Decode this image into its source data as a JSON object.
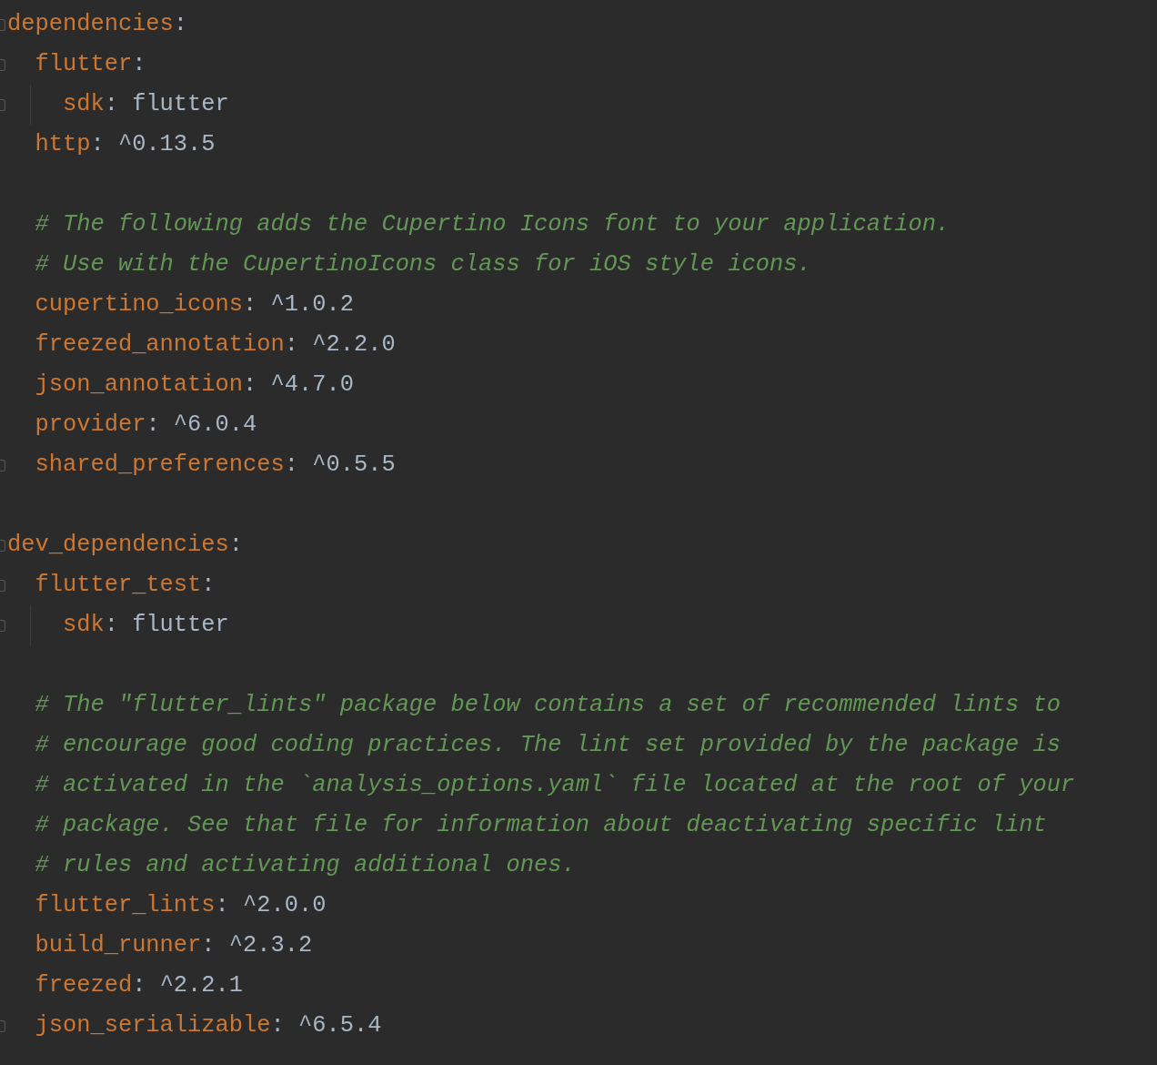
{
  "editor": {
    "lines": [
      {
        "kind": "key",
        "key": "dependencies",
        "separator": ":",
        "fold_marker": true,
        "children": [
          {
            "kind": "key",
            "key": "flutter",
            "separator": ":",
            "fold_marker": true,
            "children": [
              {
                "kind": "key",
                "key": "sdk",
                "separator": ":",
                "value": "flutter",
                "fold_marker": true
              }
            ]
          },
          {
            "kind": "key",
            "key": "http",
            "separator": ":",
            "value": "^0.13.5",
            "fold_marker": false
          },
          {
            "kind": "blank"
          },
          {
            "kind": "comment",
            "text": "# The following adds the Cupertino Icons font to your application."
          },
          {
            "kind": "comment",
            "text": "# Use with the CupertinoIcons class for iOS style icons."
          },
          {
            "kind": "key",
            "key": "cupertino_icons",
            "separator": ":",
            "value": "^1.0.2",
            "fold_marker": false
          },
          {
            "kind": "key",
            "key": "freezed_annotation",
            "separator": ":",
            "value": "^2.2.0",
            "fold_marker": false
          },
          {
            "kind": "key",
            "key": "json_annotation",
            "separator": ":",
            "value": "^4.7.0",
            "fold_marker": false
          },
          {
            "kind": "key",
            "key": "provider",
            "separator": ":",
            "value": "^6.0.4",
            "fold_marker": false
          },
          {
            "kind": "key",
            "key": "shared_preferences",
            "separator": ":",
            "value": "^0.5.5",
            "fold_marker": true
          }
        ]
      },
      {
        "kind": "blank"
      },
      {
        "kind": "key",
        "key": "dev_dependencies",
        "separator": ":",
        "fold_marker": true,
        "children": [
          {
            "kind": "key",
            "key": "flutter_test",
            "separator": ":",
            "fold_marker": true,
            "children": [
              {
                "kind": "key",
                "key": "sdk",
                "separator": ":",
                "value": "flutter",
                "fold_marker": true
              }
            ]
          },
          {
            "kind": "blank"
          },
          {
            "kind": "comment",
            "text": "# The \"flutter_lints\" package below contains a set of recommended lints to"
          },
          {
            "kind": "comment",
            "text": "# encourage good coding practices. The lint set provided by the package is"
          },
          {
            "kind": "comment",
            "text": "# activated in the `analysis_options.yaml` file located at the root of your"
          },
          {
            "kind": "comment",
            "text": "# package. See that file for information about deactivating specific lint"
          },
          {
            "kind": "comment",
            "text": "# rules and activating additional ones."
          },
          {
            "kind": "key",
            "key": "flutter_lints",
            "separator": ":",
            "value": "^2.0.0",
            "fold_marker": false
          },
          {
            "kind": "key",
            "key": "build_runner",
            "separator": ":",
            "value": "^2.3.2",
            "fold_marker": false
          },
          {
            "kind": "key",
            "key": "freezed",
            "separator": ":",
            "value": "^2.2.1",
            "fold_marker": false
          },
          {
            "kind": "key",
            "key": "json_serializable",
            "separator": ":",
            "value": "^6.5.4",
            "fold_marker": true
          }
        ]
      }
    ]
  }
}
